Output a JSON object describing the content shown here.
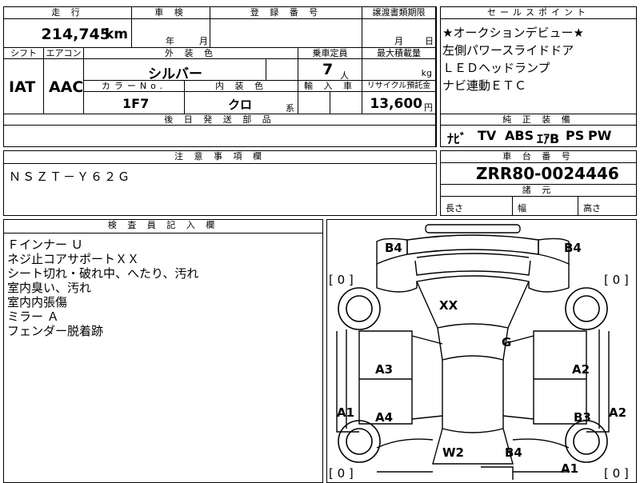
{
  "top": {
    "mileage_header": "走 行",
    "mileage_value": "214,745",
    "mileage_unit": "km",
    "inspection_header": "車 検",
    "inspection_year_unit": "年",
    "inspection_month_unit": "月",
    "registration_header": "登 録 番 号",
    "transfer_header": "譲渡書類期限",
    "transfer_month_unit": "月",
    "transfer_day_unit": "日",
    "shift_header": "シフト",
    "shift_value": "IAT",
    "aircon_header": "エアコン",
    "aircon_value": "AAC",
    "exterior_header": "外 装 色",
    "exterior_value": "シルバー",
    "capacity_header": "乗車定員",
    "capacity_value": "7",
    "capacity_unit": "人",
    "max_load_header": "最大積載量",
    "max_load_unit": "kg",
    "color_no_header": "カラーNo.",
    "color_no_value": "1F7",
    "interior_header": "内 装 色",
    "interior_value": "クロ",
    "interior_unit": "系",
    "import_header": "輸 入 車",
    "recycle_header": "リサイクル預託金",
    "recycle_value": "13,600",
    "recycle_unit": "円",
    "later_parts_header": "後 日 発 送 部 品"
  },
  "sales_points": {
    "header": "セールスポイント",
    "lines": [
      "★オークションデビュー★",
      "左側パワースライドドア",
      "ＬＥＤヘッドランプ",
      "ナビ連動ＥＴＣ"
    ]
  },
  "equipment": {
    "header": "純 正 装 備",
    "items": [
      "ﾅﾋﾞ",
      "TV",
      "ABS",
      "ｴｱB",
      "PS",
      "PW"
    ]
  },
  "notes": {
    "header": "注 意 事 項 欄",
    "value": "ＮＳＺＴ－Ｙ６２Ｇ"
  },
  "chassis": {
    "header": "車 台 番 号",
    "value": "ZRR80-0024446",
    "dims_header": "諸 元",
    "length_label": "長さ",
    "width_label": "幅",
    "height_label": "高さ"
  },
  "inspector": {
    "header": "検 査 員 記 入 欄",
    "lines": [
      "Ｆインナー Ｕ",
      "ネジ止コアサポートＸＸ",
      "シート切れ・破れ中、へたり、汚れ",
      "室内臭い、汚れ",
      "室内内張傷",
      "ミラー Ａ",
      "フェンダー脱着跡"
    ]
  },
  "diagram": {
    "tire_left_top": "[ 0 ]",
    "tire_right_top": "[ 0 ]",
    "tire_left_bottom": "[ 0 ]",
    "tire_right_bottom": "[ 0 ]",
    "marks": {
      "b4_front_left": "B4",
      "b4_front_right": "B4",
      "xx": "XX",
      "g": "G",
      "a3": "A3",
      "a2_right_door": "A2",
      "a1_left": "A1",
      "a4": "A4",
      "b3": "B3",
      "a2_right": "A2",
      "w2": "W2",
      "b4_rear": "B4",
      "a1_rear": "A1"
    }
  }
}
